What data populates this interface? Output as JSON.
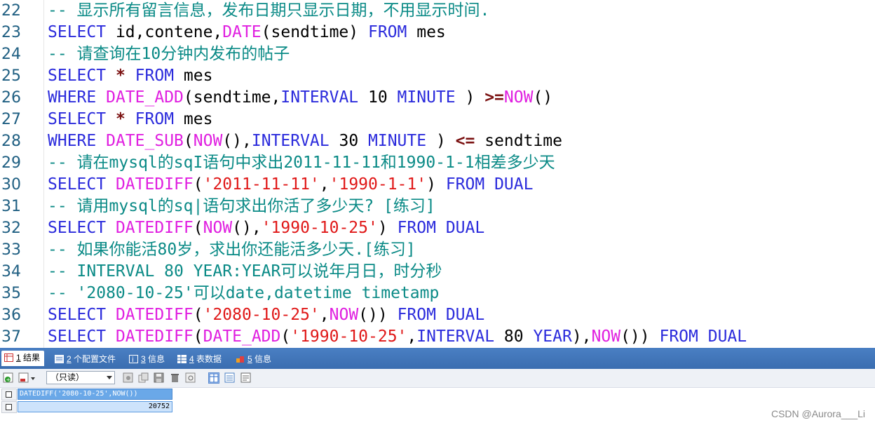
{
  "editor": {
    "lines": [
      {
        "num": "22",
        "tokens": [
          {
            "t": "-- 显示所有留言信息，发布日期只显示日期，不用显示时间.",
            "c": "cm"
          }
        ]
      },
      {
        "num": "23",
        "tokens": [
          {
            "t": "SELECT",
            "c": "kw"
          },
          {
            "t": " id,contene,",
            "c": "id"
          },
          {
            "t": "DATE",
            "c": "fn"
          },
          {
            "t": "(sendtime) ",
            "c": "id"
          },
          {
            "t": "FROM",
            "c": "kw"
          },
          {
            "t": " mes",
            "c": "id"
          }
        ]
      },
      {
        "num": "24",
        "tokens": [
          {
            "t": "-- 请查询在10分钟内发布的帖子",
            "c": "cm"
          }
        ]
      },
      {
        "num": "25",
        "tokens": [
          {
            "t": "SELECT",
            "c": "kw"
          },
          {
            "t": " ",
            "c": "id"
          },
          {
            "t": "*",
            "c": "op"
          },
          {
            "t": " ",
            "c": "id"
          },
          {
            "t": "FROM",
            "c": "kw"
          },
          {
            "t": " mes",
            "c": "id"
          }
        ]
      },
      {
        "num": "26",
        "tokens": [
          {
            "t": "WHERE",
            "c": "kw"
          },
          {
            "t": " ",
            "c": "id"
          },
          {
            "t": "DATE_ADD",
            "c": "fn"
          },
          {
            "t": "(sendtime,",
            "c": "id"
          },
          {
            "t": "INTERVAL",
            "c": "kw"
          },
          {
            "t": " 10 ",
            "c": "num"
          },
          {
            "t": "MINUTE",
            "c": "kw"
          },
          {
            "t": " ) ",
            "c": "id"
          },
          {
            "t": ">=",
            "c": "op"
          },
          {
            "t": "NOW",
            "c": "fn"
          },
          {
            "t": "()",
            "c": "id"
          }
        ]
      },
      {
        "num": "27",
        "tokens": [
          {
            "t": "SELECT",
            "c": "kw"
          },
          {
            "t": " ",
            "c": "id"
          },
          {
            "t": "*",
            "c": "op"
          },
          {
            "t": " ",
            "c": "id"
          },
          {
            "t": "FROM",
            "c": "kw"
          },
          {
            "t": " mes",
            "c": "id"
          }
        ]
      },
      {
        "num": "28",
        "tokens": [
          {
            "t": "WHERE",
            "c": "kw"
          },
          {
            "t": " ",
            "c": "id"
          },
          {
            "t": "DATE_SUB",
            "c": "fn"
          },
          {
            "t": "(",
            "c": "id"
          },
          {
            "t": "NOW",
            "c": "fn"
          },
          {
            "t": "(),",
            "c": "id"
          },
          {
            "t": "INTERVAL",
            "c": "kw"
          },
          {
            "t": " 30 ",
            "c": "num"
          },
          {
            "t": "MINUTE",
            "c": "kw"
          },
          {
            "t": " ) ",
            "c": "id"
          },
          {
            "t": "<=",
            "c": "op"
          },
          {
            "t": " sendtime",
            "c": "id"
          }
        ]
      },
      {
        "num": "29",
        "tokens": [
          {
            "t": "-- 请在mysql的sqI语句中求出2011-11-11和1990-1-1相差多少天",
            "c": "cm"
          }
        ]
      },
      {
        "num": "30",
        "tokens": [
          {
            "t": "SELECT",
            "c": "kw"
          },
          {
            "t": " ",
            "c": "id"
          },
          {
            "t": "DATEDIFF",
            "c": "fn"
          },
          {
            "t": "(",
            "c": "id"
          },
          {
            "t": "'2011-11-11'",
            "c": "str"
          },
          {
            "t": ",",
            "c": "id"
          },
          {
            "t": "'1990-1-1'",
            "c": "str"
          },
          {
            "t": ") ",
            "c": "id"
          },
          {
            "t": "FROM",
            "c": "kw"
          },
          {
            "t": " ",
            "c": "id"
          },
          {
            "t": "DUAL",
            "c": "kw"
          }
        ]
      },
      {
        "num": "31",
        "tokens": [
          {
            "t": "-- 请用mysql的sq|语句求出你活了多少天? [练习]",
            "c": "cm"
          }
        ]
      },
      {
        "num": "32",
        "tokens": [
          {
            "t": "SELECT",
            "c": "kw"
          },
          {
            "t": " ",
            "c": "id"
          },
          {
            "t": "DATEDIFF",
            "c": "fn"
          },
          {
            "t": "(",
            "c": "id"
          },
          {
            "t": "NOW",
            "c": "fn"
          },
          {
            "t": "(),",
            "c": "id"
          },
          {
            "t": "'1990-10-25'",
            "c": "str"
          },
          {
            "t": ") ",
            "c": "id"
          },
          {
            "t": "FROM",
            "c": "kw"
          },
          {
            "t": " ",
            "c": "id"
          },
          {
            "t": "DUAL",
            "c": "kw"
          }
        ]
      },
      {
        "num": "33",
        "tokens": [
          {
            "t": "-- 如果你能活80岁，求出你还能活多少天.[练习]",
            "c": "cm"
          }
        ]
      },
      {
        "num": "34",
        "tokens": [
          {
            "t": "-- INTERVAL 80 YEAR:YEAR可以说年月日，时分秒",
            "c": "cm"
          }
        ]
      },
      {
        "num": "35",
        "tokens": [
          {
            "t": "-- '2080-10-25'可以date,datetime timetamp",
            "c": "cm"
          }
        ]
      },
      {
        "num": "36",
        "tokens": [
          {
            "t": "SELECT",
            "c": "kw"
          },
          {
            "t": " ",
            "c": "id"
          },
          {
            "t": "DATEDIFF",
            "c": "fn"
          },
          {
            "t": "(",
            "c": "id"
          },
          {
            "t": "'2080-10-25'",
            "c": "str"
          },
          {
            "t": ",",
            "c": "id"
          },
          {
            "t": "NOW",
            "c": "fn"
          },
          {
            "t": "()) ",
            "c": "id"
          },
          {
            "t": "FROM",
            "c": "kw"
          },
          {
            "t": " ",
            "c": "id"
          },
          {
            "t": "DUAL",
            "c": "kw"
          }
        ]
      },
      {
        "num": "37",
        "tokens": [
          {
            "t": "SELECT",
            "c": "kw"
          },
          {
            "t": " ",
            "c": "id"
          },
          {
            "t": "DATEDIFF",
            "c": "fn"
          },
          {
            "t": "(",
            "c": "id"
          },
          {
            "t": "DATE_ADD",
            "c": "fn"
          },
          {
            "t": "(",
            "c": "id"
          },
          {
            "t": "'1990-10-25'",
            "c": "str"
          },
          {
            "t": ",",
            "c": "id"
          },
          {
            "t": "INTERVAL",
            "c": "kw"
          },
          {
            "t": " 80 ",
            "c": "num"
          },
          {
            "t": "YEAR",
            "c": "kw"
          },
          {
            "t": "),",
            "c": "id"
          },
          {
            "t": "NOW",
            "c": "fn"
          },
          {
            "t": "()) ",
            "c": "id"
          },
          {
            "t": "FROM",
            "c": "kw"
          },
          {
            "t": " ",
            "c": "id"
          },
          {
            "t": "DUAL",
            "c": "kw"
          }
        ]
      }
    ]
  },
  "results_panel": {
    "tabs": [
      {
        "num": "1",
        "label": "结果",
        "icon": "result-grid-icon"
      },
      {
        "num": "2",
        "label": "个配置文件",
        "icon": "profile-icon"
      },
      {
        "num": "3",
        "label": "信息",
        "icon": "info-icon"
      },
      {
        "num": "4",
        "label": "表数据",
        "icon": "table-data-icon"
      },
      {
        "num": "5",
        "label": "信息",
        "icon": "info-icon"
      }
    ],
    "toolbar": {
      "mode_select": "（只读）"
    },
    "grid": {
      "column_header": "DATEDIFF('2080-10-25',NOW())",
      "rows": [
        {
          "value": "20752"
        }
      ]
    }
  },
  "watermark": "CSDN @Aurora___Li",
  "colors": {
    "keyword": "#2b2bdc",
    "function": "#e020e0",
    "string": "#e01818",
    "comment": "#0a8a86",
    "tab_bar": "#3a6db0"
  }
}
